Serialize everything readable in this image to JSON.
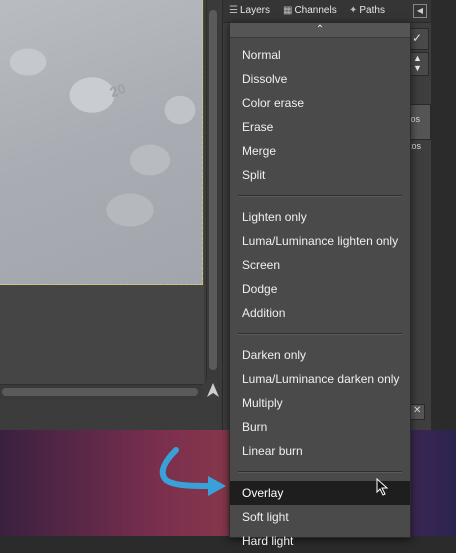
{
  "dock": {
    "tabs": [
      {
        "label": "Layers",
        "icon": "layers-icon"
      },
      {
        "label": "Channels",
        "icon": "channels-icon"
      },
      {
        "label": "Paths",
        "icon": "paths-icon"
      }
    ],
    "partial_text": [
      "tos",
      "tos"
    ]
  },
  "image": {
    "coin_text": "20"
  },
  "menu": {
    "scroll_up_glyph": "⌃",
    "groups": [
      [
        "Normal",
        "Dissolve",
        "Color erase",
        "Erase",
        "Merge",
        "Split"
      ],
      [
        "Lighten only",
        "Luma/Luminance lighten only",
        "Screen",
        "Dodge",
        "Addition"
      ],
      [
        "Darken only",
        "Luma/Luminance darken only",
        "Multiply",
        "Burn",
        "Linear burn"
      ],
      [
        "Overlay",
        "Soft light",
        "Hard light"
      ]
    ],
    "selected": "Overlay"
  },
  "colors": {
    "arrow": "#3aa0d8",
    "selected_bg": "#1e1e1e",
    "menu_bg": "#4a4a4a"
  }
}
